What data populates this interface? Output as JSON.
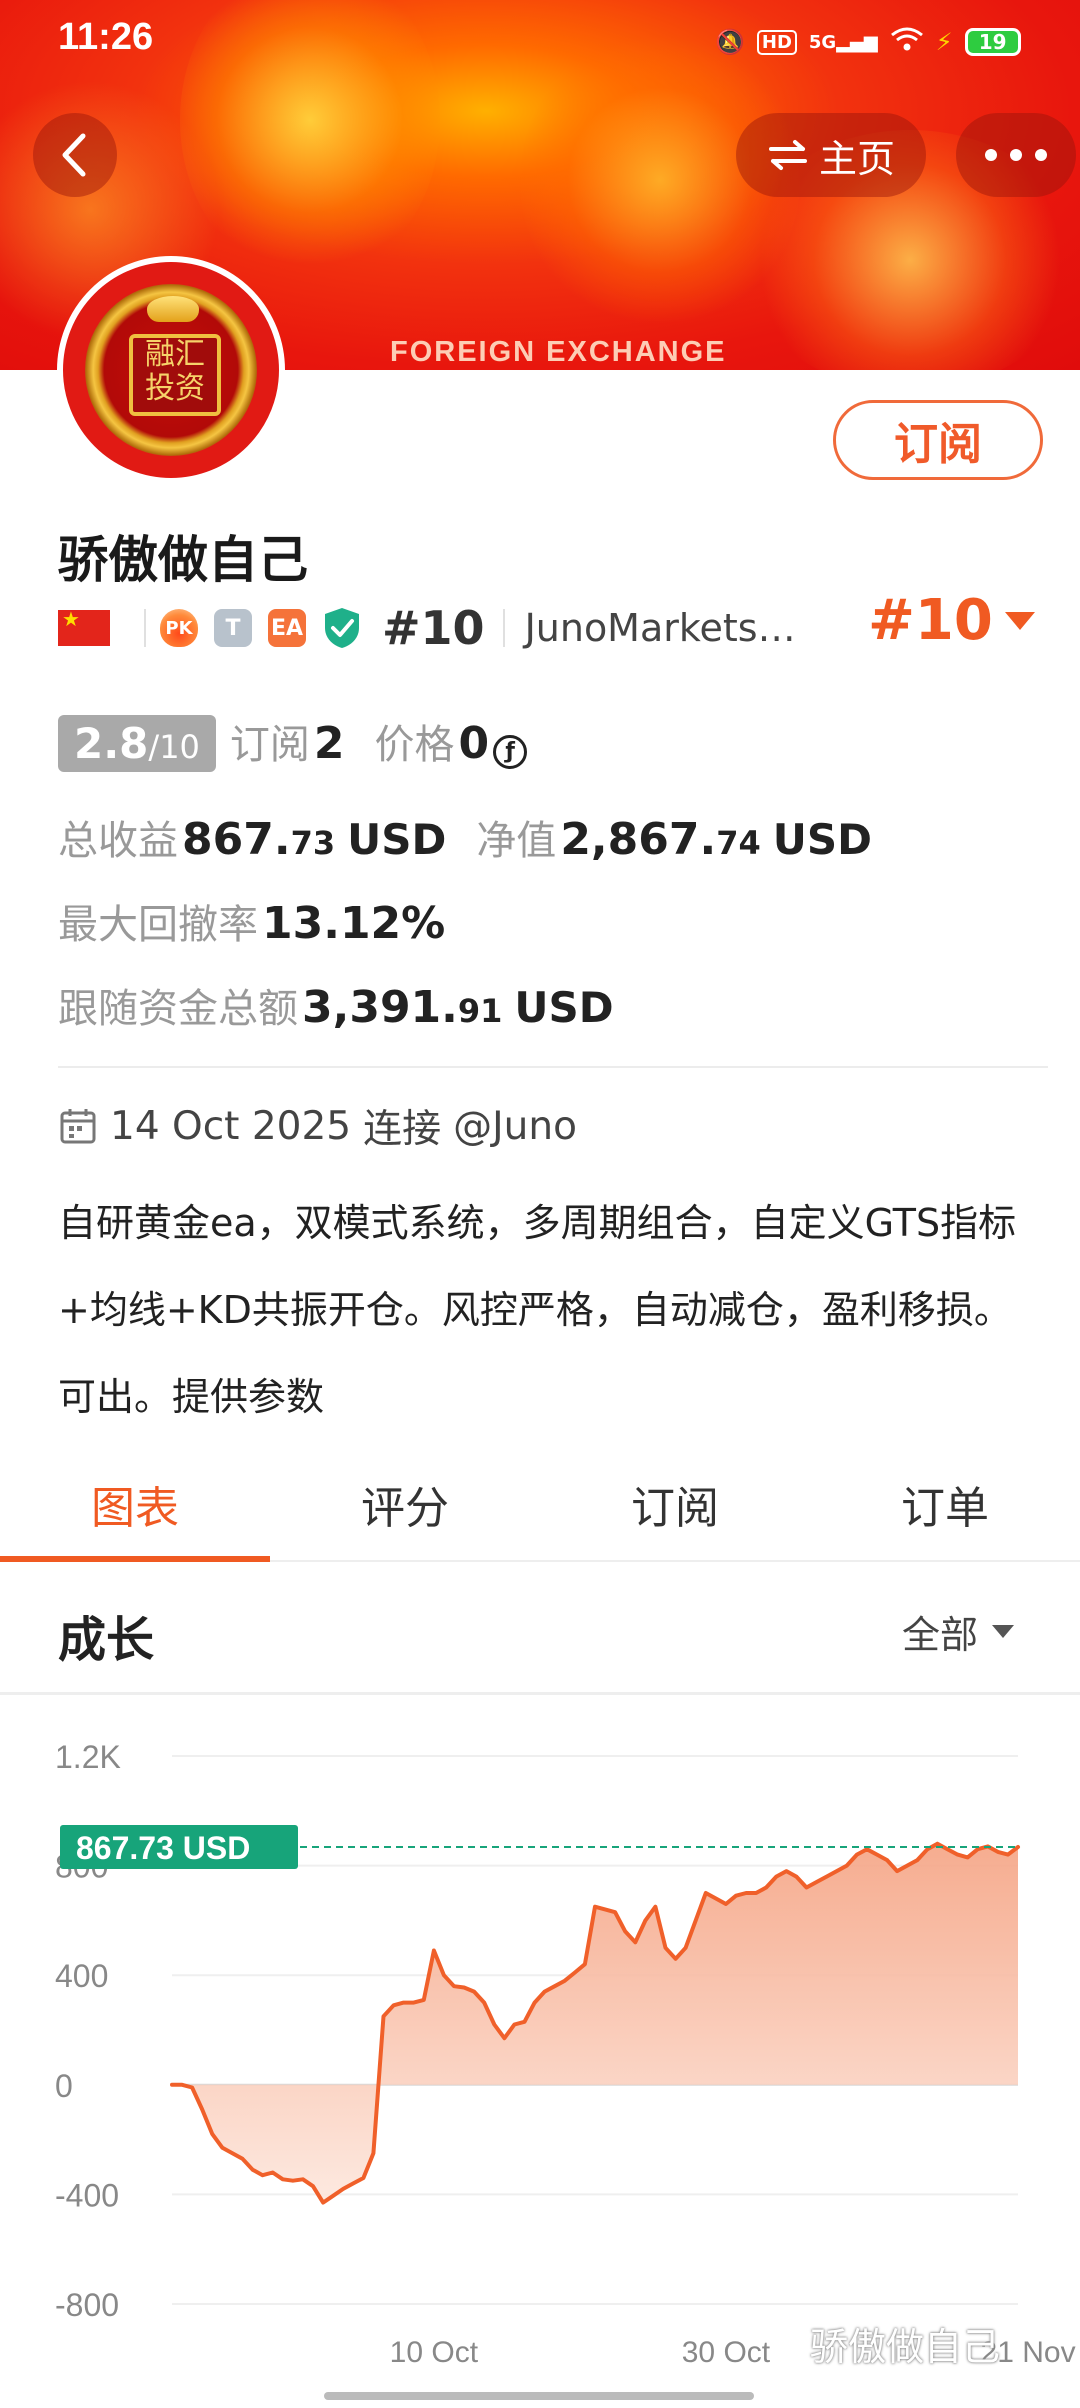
{
  "status_bar": {
    "time": "11:26",
    "battery": "19",
    "network": "5G",
    "hd": "HD"
  },
  "header": {
    "banner_text": "FOREIGN EXCHANGE",
    "home_label": "主页",
    "avatar_text": "融汇\n投资"
  },
  "profile": {
    "subscribe_label": "订阅",
    "name": "骄傲做自己",
    "badges": [
      "PK",
      "T",
      "EA"
    ],
    "rank_small": "#10",
    "broker": "JunoMarkets…",
    "rank_big": "#10"
  },
  "stats": {
    "score_main": "2.8",
    "score_denom": "/10",
    "subscriptions_label": "订阅",
    "subscriptions_value": "2",
    "price_label": "价格",
    "price_value": "0",
    "total_profit_label": "总收益",
    "total_profit_int": "867.",
    "total_profit_dec": "73",
    "total_profit_unit": "USD",
    "equity_label": "净值",
    "equity_int": "2,867.",
    "equity_dec": "74",
    "equity_unit": "USD",
    "max_drawdown_label": "最大回撤率",
    "max_drawdown_value": "13.12%",
    "follow_total_label": "跟随资金总额",
    "follow_total_int": "3,391.",
    "follow_total_dec": "91",
    "follow_total_unit": "USD"
  },
  "connection": {
    "date": "14 Oct 2025",
    "connected_label": "连接",
    "handle": "@Juno"
  },
  "description": "自研黄金ea，双模式系统，多周期组合，自定义GTS指标+均线+KD共振开仓。风控严格，自动减仓，盈利移损。可出。提供参数",
  "tabs": [
    {
      "label": "图表",
      "active": true
    },
    {
      "label": "评分",
      "active": false
    },
    {
      "label": "订阅",
      "active": false
    },
    {
      "label": "订单",
      "active": false
    }
  ],
  "growth": {
    "title": "成长",
    "filter_label": "全部"
  },
  "chart_data": {
    "type": "area",
    "ylim": [
      -800,
      1200
    ],
    "y_ticks": [
      "1.2K",
      "800",
      "400",
      "0",
      "-400",
      "-800"
    ],
    "y_tick_values": [
      1200,
      800,
      400,
      0,
      -400,
      -800
    ],
    "x_tick_labels": [
      "10 Oct",
      "30 Oct",
      "21 Nov"
    ],
    "x_tick_index": [
      26,
      55,
      85
    ],
    "current_label": "867.73 USD",
    "current_value": 867.73,
    "colors": {
      "line": "#f0602a",
      "fill_top": "#f5a383",
      "fill_bottom": "#fde7dd",
      "label_bg": "#17a47a",
      "dash": "#17a47a"
    },
    "values": [
      0,
      0,
      -10,
      -90,
      -180,
      -230,
      -250,
      -270,
      -310,
      -330,
      -320,
      -345,
      -350,
      -345,
      -370,
      -430,
      -405,
      -380,
      -360,
      -340,
      -250,
      250,
      290,
      300,
      300,
      310,
      490,
      400,
      360,
      355,
      340,
      300,
      220,
      170,
      220,
      230,
      300,
      340,
      360,
      380,
      410,
      440,
      650,
      640,
      630,
      560,
      520,
      600,
      650,
      500,
      460,
      500,
      600,
      700,
      680,
      660,
      690,
      700,
      700,
      720,
      760,
      780,
      760,
      720,
      740,
      760,
      780,
      800,
      840,
      860,
      840,
      820,
      780,
      800,
      820,
      860,
      880,
      860,
      840,
      830,
      860,
      870,
      850,
      840,
      867.73
    ]
  },
  "watermark": "骄傲做自己"
}
